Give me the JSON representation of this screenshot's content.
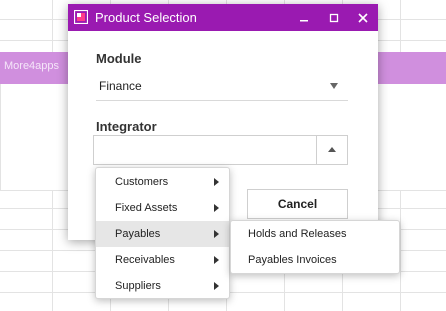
{
  "background": {
    "banner_text": "More4apps"
  },
  "dialog": {
    "title": "Product Selection",
    "module_label": "Module",
    "module_value": "Finance",
    "integrator_label": "Integrator",
    "integrator_value": "",
    "cancel_label": "Cancel"
  },
  "menu": {
    "items": [
      {
        "label": "Customers"
      },
      {
        "label": "Fixed Assets"
      },
      {
        "label": "Payables",
        "active": true
      },
      {
        "label": "Receivables"
      },
      {
        "label": "Suppliers"
      }
    ]
  },
  "submenu": {
    "items": [
      {
        "label": "Holds and Releases"
      },
      {
        "label": "Payables Invoices"
      }
    ]
  },
  "colors": {
    "titlebar": "#9a1ab1",
    "banner": "#d08fde"
  }
}
